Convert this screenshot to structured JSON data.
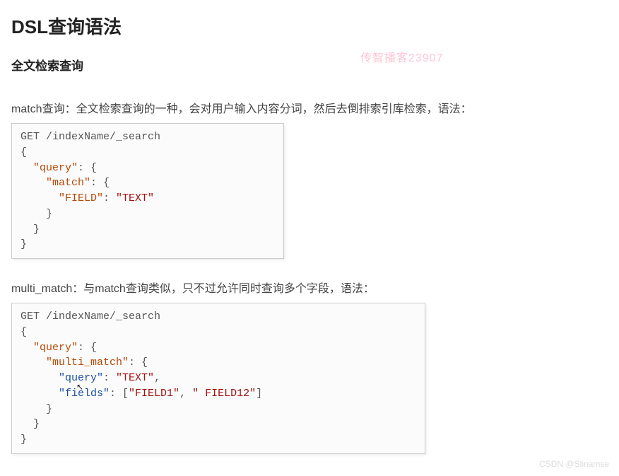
{
  "title": "DSL查询语法",
  "subtitle": "全文检索查询",
  "watermark_top": "传智播客23907",
  "watermark_bottom": "CSDN @Slinamse",
  "section1": {
    "desc": "match查询：全文检索查询的一种，会对用户输入内容分词，然后去倒排索引库检索，语法：",
    "code": {
      "l1": "GET /indexName/_search",
      "l2": "{",
      "l3_k": "\"query\"",
      "l3_r": ": {",
      "l4_k": "\"match\"",
      "l4_r": ": {",
      "l5_k": "\"FIELD\"",
      "l5_m": ": ",
      "l5_v": "\"TEXT\"",
      "l6": "    }",
      "l7": "  }",
      "l8": "}"
    }
  },
  "section2": {
    "desc": "multi_match：与match查询类似，只不过允许同时查询多个字段，语法：",
    "code": {
      "l1": "GET /indexName/_search",
      "l2": "{",
      "l3_k": "\"query\"",
      "l3_r": ": {",
      "l4_k": "\"multi_match\"",
      "l4_r": ": {",
      "l5_k": "\"query\"",
      "l5_m": ": ",
      "l5_v": "\"TEXT\"",
      "l5_c": ",",
      "l6_k": "\"fields\"",
      "l6_m": ": [",
      "l6_v1": "\"FIELD1\"",
      "l6_s": ", ",
      "l6_v2": "\" FIELD12\"",
      "l6_e": "]",
      "l7": "    }",
      "l8": "  }",
      "l9": "}"
    }
  }
}
